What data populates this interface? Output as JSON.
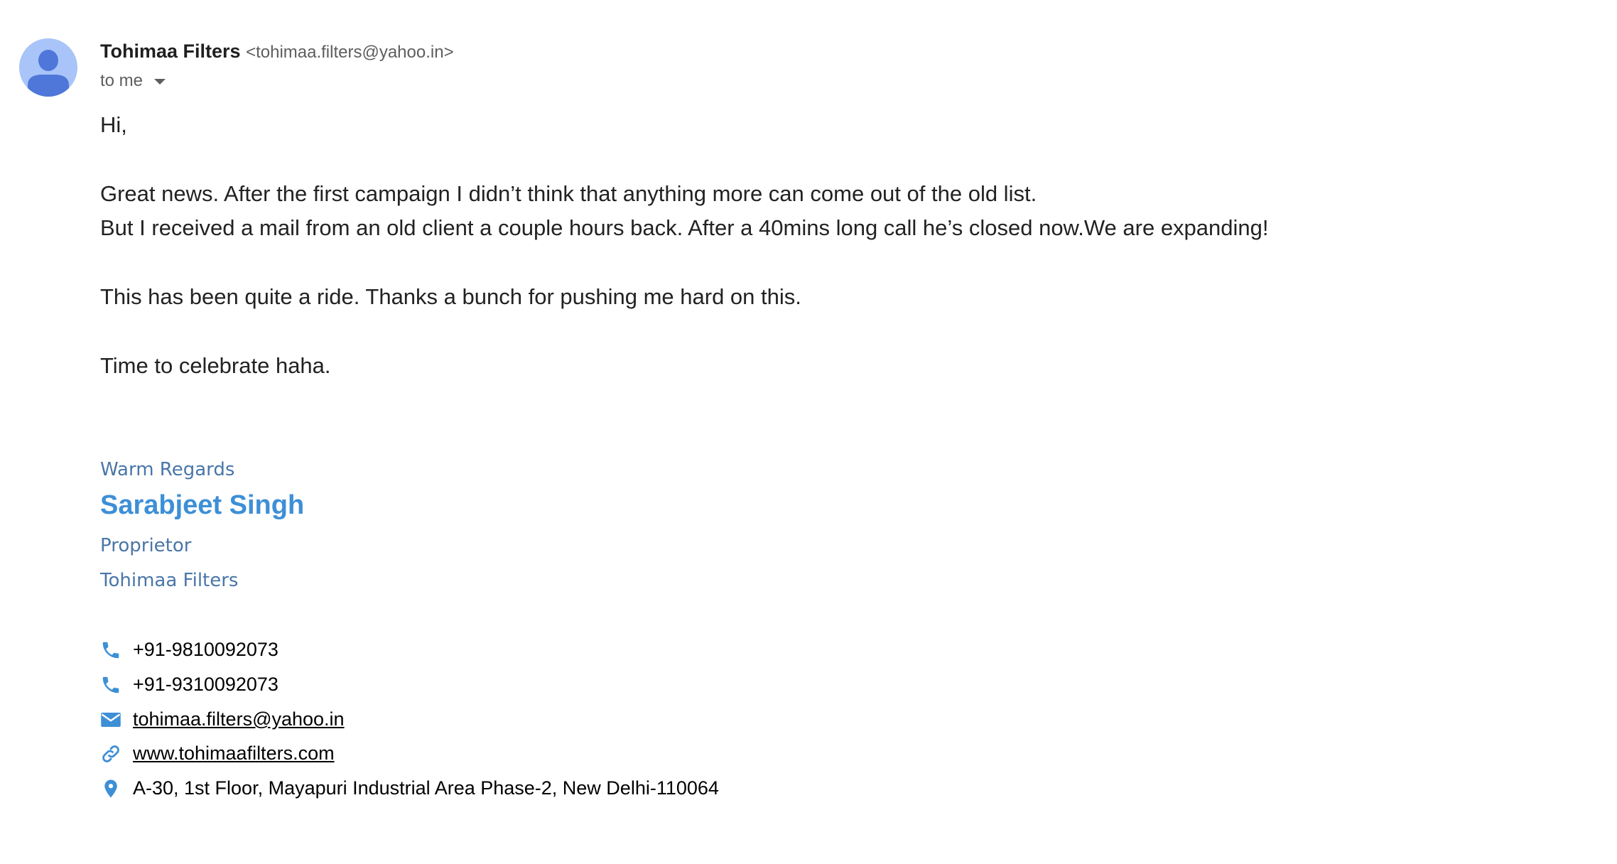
{
  "header": {
    "sender_name": "Tohimaa Filters",
    "sender_email": "<tohimaa.filters@yahoo.in>",
    "recipient": "to me",
    "recipient_icon": "caret-down-icon",
    "avatar_icon": "person-icon"
  },
  "body": {
    "greeting": "Hi,",
    "lines": [
      "Great news. After the first campaign I didn’t think that anything more can come out of the old list.",
      "But I received a mail from an old client a couple hours back. After a 40mins long call he’s closed now.We are expanding!",
      "This has been quite a ride. Thanks a bunch for pushing me hard on this.",
      "Time to celebrate haha."
    ]
  },
  "signature": {
    "closing": "Warm Regards",
    "name": "Sarabjeet Singh",
    "title": "Proprietor",
    "company": "Tohimaa Filters",
    "contacts": [
      {
        "icon": "phone-icon",
        "text": "+91-9810092073"
      },
      {
        "icon": "phone-icon",
        "text": "+91-9310092073"
      },
      {
        "icon": "mail-icon",
        "text": "tohimaa.filters@yahoo.in"
      },
      {
        "icon": "link-icon",
        "text": "www.tohimaafilters.com"
      },
      {
        "icon": "location-pin-icon",
        "text": "A-30, 1st Floor, Mayapuri Industrial Area Phase-2, New Delhi-110064"
      }
    ]
  },
  "colors": {
    "accent": "#3d8fd6",
    "signature_text": "#4a76a8",
    "avatar_bg": "#a8c4f8",
    "avatar_fg": "#4f77d9"
  }
}
